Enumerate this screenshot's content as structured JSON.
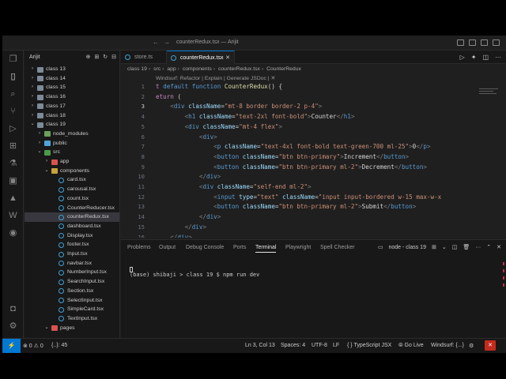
{
  "window": {
    "title": "counterRedux.tsx — Arijit"
  },
  "sidebar": {
    "workspace_name": "Arijit",
    "tree": [
      {
        "label": "class 13",
        "type": "folder",
        "depth": 0,
        "expanded": false
      },
      {
        "label": "class 14",
        "type": "folder",
        "depth": 0,
        "expanded": false
      },
      {
        "label": "class 15",
        "type": "folder",
        "depth": 0,
        "expanded": false
      },
      {
        "label": "class 16",
        "type": "folder",
        "depth": 0,
        "expanded": false
      },
      {
        "label": "class 17",
        "type": "folder",
        "depth": 0,
        "expanded": false
      },
      {
        "label": "class 18",
        "type": "folder",
        "depth": 0,
        "expanded": false
      },
      {
        "label": "class 19",
        "type": "folder",
        "depth": 0,
        "expanded": true
      },
      {
        "label": "node_modules",
        "type": "folder-node",
        "depth": 1,
        "expanded": false
      },
      {
        "label": "public",
        "type": "folder-public",
        "depth": 1,
        "expanded": false
      },
      {
        "label": "src",
        "type": "folder-src",
        "depth": 1,
        "expanded": true
      },
      {
        "label": "app",
        "type": "folder-red",
        "depth": 2,
        "expanded": false
      },
      {
        "label": "components",
        "type": "folder-comp",
        "depth": 2,
        "expanded": true
      },
      {
        "label": "card.tsx",
        "type": "tsx",
        "depth": 3
      },
      {
        "label": "carousal.tsx",
        "type": "tsx",
        "depth": 3
      },
      {
        "label": "count.tsx",
        "type": "tsx",
        "depth": 3
      },
      {
        "label": "CounterReducer.tsx",
        "type": "tsx",
        "depth": 3
      },
      {
        "label": "counterRedux.tsx",
        "type": "tsx",
        "depth": 3,
        "selected": true
      },
      {
        "label": "dashboard.tsx",
        "type": "tsx",
        "depth": 3
      },
      {
        "label": "Display.tsx",
        "type": "tsx",
        "depth": 3
      },
      {
        "label": "footer.tsx",
        "type": "tsx",
        "depth": 3
      },
      {
        "label": "Input.tsx",
        "type": "tsx",
        "depth": 3
      },
      {
        "label": "navbar.tsx",
        "type": "tsx",
        "depth": 3
      },
      {
        "label": "NumberInput.tsx",
        "type": "tsx",
        "depth": 3
      },
      {
        "label": "SearchInput.tsx",
        "type": "tsx",
        "depth": 3
      },
      {
        "label": "Section.tsx",
        "type": "tsx",
        "depth": 3
      },
      {
        "label": "SelectInput.tsx",
        "type": "tsx",
        "depth": 3
      },
      {
        "label": "SimpleCard.tsx",
        "type": "tsx",
        "depth": 3
      },
      {
        "label": "TextInput.tsx",
        "type": "tsx",
        "depth": 3
      },
      {
        "label": "pages",
        "type": "folder-red",
        "depth": 2,
        "expanded": true
      }
    ]
  },
  "editor": {
    "tabs": [
      {
        "label": "store.ts",
        "active": false
      },
      {
        "label": "counterRedux.tsx",
        "active": true
      }
    ],
    "breadcrumb": [
      "class 19",
      "src",
      "app",
      "components",
      "counterRedux.tsx",
      "CounterRedux"
    ],
    "codelens": "Windsurf: Refactor | Explain | Generate JSDoc | ✕",
    "current_line": 3,
    "lines": [
      {
        "n": "1",
        "tokens": [
          [
            "kw",
            "t "
          ],
          [
            "k",
            "default "
          ],
          [
            "k",
            "function "
          ],
          [
            "fn",
            "CounterRedux"
          ],
          [
            "tx",
            "() {"
          ]
        ]
      },
      {
        "n": "2",
        "tokens": [
          [
            "kw",
            "eturn "
          ],
          [
            "tx",
            "("
          ]
        ]
      },
      {
        "n": "3",
        "tokens": [
          [
            "tx",
            "    "
          ],
          [
            "pn",
            "<"
          ],
          [
            "tg",
            "div "
          ],
          [
            "at",
            "className"
          ],
          [
            "tx",
            "="
          ],
          [
            "st",
            "\"mt-8 border border-2 p-4\""
          ],
          [
            "pn",
            ">"
          ]
        ]
      },
      {
        "n": "4",
        "tokens": [
          [
            "tx",
            "        "
          ],
          [
            "pn",
            "<"
          ],
          [
            "tg",
            "h1 "
          ],
          [
            "at",
            "className"
          ],
          [
            "tx",
            "="
          ],
          [
            "st",
            "\"text-2xl font-bold\""
          ],
          [
            "pn",
            ">"
          ],
          [
            "tx",
            "Counter"
          ],
          [
            "pn",
            "</"
          ],
          [
            "tg",
            "h1"
          ],
          [
            "pn",
            ">"
          ]
        ]
      },
      {
        "n": "5",
        "tokens": [
          [
            "tx",
            "        "
          ],
          [
            "pn",
            "<"
          ],
          [
            "tg",
            "div "
          ],
          [
            "at",
            "className"
          ],
          [
            "tx",
            "="
          ],
          [
            "st",
            "\"mt-4 flex\""
          ],
          [
            "pn",
            ">"
          ]
        ]
      },
      {
        "n": "6",
        "tokens": [
          [
            "tx",
            "            "
          ],
          [
            "pn",
            "<"
          ],
          [
            "tg",
            "div"
          ],
          [
            "pn",
            ">"
          ]
        ]
      },
      {
        "n": "7",
        "tokens": [
          [
            "tx",
            "                "
          ],
          [
            "pn",
            "<"
          ],
          [
            "tg",
            "p "
          ],
          [
            "at",
            "className"
          ],
          [
            "tx",
            "="
          ],
          [
            "st",
            "\"text-4xl font-bold text-green-700 ml-25\""
          ],
          [
            "pn",
            ">"
          ],
          [
            "tx",
            "0"
          ],
          [
            "pn",
            "</"
          ],
          [
            "tg",
            "p"
          ],
          [
            "pn",
            ">"
          ]
        ]
      },
      {
        "n": "8",
        "tokens": [
          [
            "tx",
            "                "
          ],
          [
            "pn",
            "<"
          ],
          [
            "tg",
            "button "
          ],
          [
            "at",
            "className"
          ],
          [
            "tx",
            "="
          ],
          [
            "st",
            "\"btn btn-primary\""
          ],
          [
            "pn",
            ">"
          ],
          [
            "tx",
            "Increment"
          ],
          [
            "pn",
            "</"
          ],
          [
            "tg",
            "button"
          ],
          [
            "pn",
            ">"
          ]
        ]
      },
      {
        "n": "9",
        "tokens": [
          [
            "tx",
            "                "
          ],
          [
            "pn",
            "<"
          ],
          [
            "tg",
            "button "
          ],
          [
            "at",
            "className"
          ],
          [
            "tx",
            "="
          ],
          [
            "st",
            "\"btn btn-primary ml-2\""
          ],
          [
            "pn",
            ">"
          ],
          [
            "tx",
            "Decrement"
          ],
          [
            "pn",
            "</"
          ],
          [
            "tg",
            "button"
          ],
          [
            "pn",
            ">"
          ]
        ]
      },
      {
        "n": "10",
        "tokens": [
          [
            "tx",
            "            "
          ],
          [
            "pn",
            "</"
          ],
          [
            "tg",
            "div"
          ],
          [
            "pn",
            ">"
          ]
        ]
      },
      {
        "n": "11",
        "tokens": [
          [
            "tx",
            "            "
          ],
          [
            "pn",
            "<"
          ],
          [
            "tg",
            "div "
          ],
          [
            "at",
            "className"
          ],
          [
            "tx",
            "="
          ],
          [
            "st",
            "\"self-end ml-2\""
          ],
          [
            "pn",
            ">"
          ]
        ]
      },
      {
        "n": "12",
        "tokens": [
          [
            "tx",
            "                "
          ],
          [
            "pn",
            "<"
          ],
          [
            "tg",
            "input "
          ],
          [
            "at",
            "type"
          ],
          [
            "tx",
            "="
          ],
          [
            "st",
            "\"text\" "
          ],
          [
            "at",
            "className"
          ],
          [
            "tx",
            "="
          ],
          [
            "st",
            "\"input input-bordered w-15 max-w-x"
          ]
        ]
      },
      {
        "n": "13",
        "tokens": [
          [
            "tx",
            "                "
          ],
          [
            "pn",
            "<"
          ],
          [
            "tg",
            "button "
          ],
          [
            "at",
            "className"
          ],
          [
            "tx",
            "="
          ],
          [
            "st",
            "\"btn btn-primary ml-2\""
          ],
          [
            "pn",
            ">"
          ],
          [
            "tx",
            "Submit"
          ],
          [
            "pn",
            "</"
          ],
          [
            "tg",
            "button"
          ],
          [
            "pn",
            ">"
          ]
        ]
      },
      {
        "n": "14",
        "tokens": [
          [
            "tx",
            "            "
          ],
          [
            "pn",
            "</"
          ],
          [
            "tg",
            "div"
          ],
          [
            "pn",
            ">"
          ]
        ]
      },
      {
        "n": "15",
        "tokens": [
          [
            "tx",
            "        "
          ],
          [
            "pn",
            "</"
          ],
          [
            "tg",
            "div"
          ],
          [
            "pn",
            ">"
          ]
        ]
      },
      {
        "n": "16",
        "tokens": [
          [
            "tx",
            "    "
          ],
          [
            "pn",
            "</"
          ],
          [
            "tg",
            "div"
          ],
          [
            "pn",
            ">"
          ]
        ]
      }
    ]
  },
  "panel": {
    "tabs": [
      {
        "label": "Problems",
        "active": false
      },
      {
        "label": "Output",
        "active": false
      },
      {
        "label": "Debug Console",
        "active": false
      },
      {
        "label": "Ports",
        "active": false
      },
      {
        "label": "Terminal",
        "active": true
      },
      {
        "label": "Playwright",
        "active": false
      },
      {
        "label": "Spell Checker",
        "active": false
      }
    ],
    "terminal_name": "node - class 19",
    "terminal_lines": [
      "(base) shibaji > class 19 $ npm run dev"
    ]
  },
  "statusbar": {
    "problems": "⊗ 0 ⚠ 0",
    "left_extra": "{..}: 45",
    "position": "Ln 3, Col 13",
    "spaces": "Spaces: 4",
    "encoding": "UTF-8",
    "eol": "LF",
    "language": "{ } TypeScript JSX",
    "golive": "⦾ Go Live",
    "windsurf": "Windsurf: {...}"
  },
  "colors": {
    "accent": "#0078d4",
    "editor_bg": "#1f1f1f",
    "sidebar_bg": "#181818",
    "alert": "#c42b1c"
  }
}
